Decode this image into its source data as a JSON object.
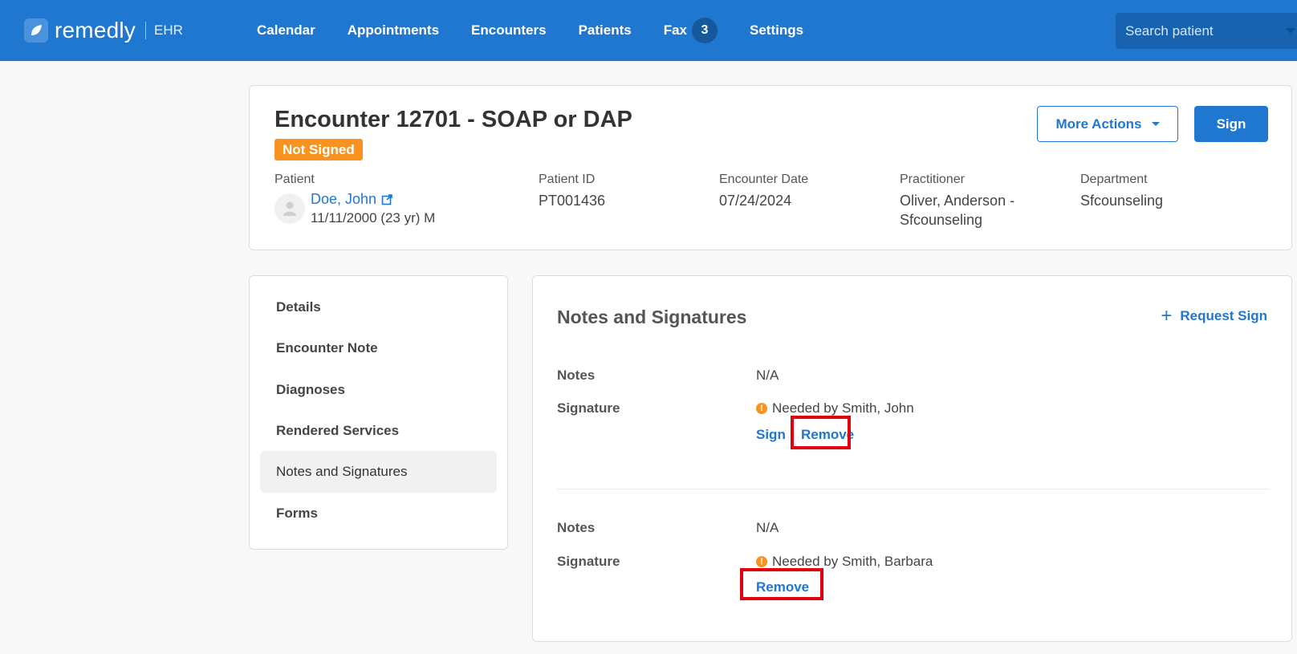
{
  "brand": {
    "name": "remedly",
    "suffix": "EHR"
  },
  "nav": {
    "calendar": "Calendar",
    "appointments": "Appointments",
    "encounters": "Encounters",
    "patients": "Patients",
    "fax": "Fax",
    "fax_count": "3",
    "settings": "Settings"
  },
  "search": {
    "placeholder": "Search patient"
  },
  "encounter": {
    "title": "Encounter 12701 - SOAP or DAP",
    "status": "Not Signed",
    "more_actions": "More Actions",
    "sign": "Sign",
    "patient_label": "Patient",
    "patient_name": "Doe, John",
    "patient_dob": "11/11/2000 (23 yr) M",
    "patient_id_label": "Patient ID",
    "patient_id": "PT001436",
    "date_label": "Encounter Date",
    "date": "07/24/2024",
    "practitioner_label": "Practitioner",
    "practitioner_line1": "Oliver, Anderson -",
    "practitioner_line2": "Sfcounseling",
    "department_label": "Department",
    "department": "Sfcounseling"
  },
  "side_menu": {
    "details": "Details",
    "encounter_note": "Encounter Note",
    "diagnoses": "Diagnoses",
    "rendered_services": "Rendered Services",
    "notes_and_signatures": "Notes and Signatures",
    "forms": "Forms"
  },
  "notes": {
    "title": "Notes and Signatures",
    "request_sign": "Request Sign",
    "notes_label": "Notes",
    "signature_label": "Signature",
    "entries": [
      {
        "notes": "N/A",
        "signature": "Needed by Smith, John",
        "sign": "Sign",
        "remove": "Remove"
      },
      {
        "notes": "N/A",
        "signature": "Needed by Smith, Barbara",
        "remove": "Remove"
      }
    ]
  },
  "colors": {
    "primary": "#1f77d0",
    "warning": "#f7931e",
    "highlight": "#e00010"
  }
}
